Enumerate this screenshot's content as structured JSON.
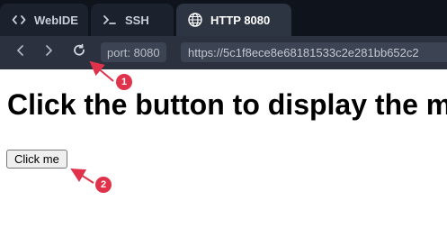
{
  "tabs": [
    {
      "label": "WebIDE",
      "icon": "code-icon",
      "active": false
    },
    {
      "label": "SSH",
      "icon": "terminal-icon",
      "active": false
    },
    {
      "label": "HTTP 8080",
      "icon": "globe-icon",
      "active": true
    }
  ],
  "address_bar": {
    "port_label": "port: 8080",
    "url": "https://5c1f8ece8e68181533c2e281bb652c2"
  },
  "page": {
    "heading": "Click the button to display the m",
    "button_label": "Click me"
  },
  "annotations": [
    {
      "label": "1"
    },
    {
      "label": "2"
    }
  ],
  "colors": {
    "tab_background": "#0f131c",
    "active_tab": "#2d3442",
    "address_bar": "#2b313e",
    "annotation": "#e0324b"
  }
}
